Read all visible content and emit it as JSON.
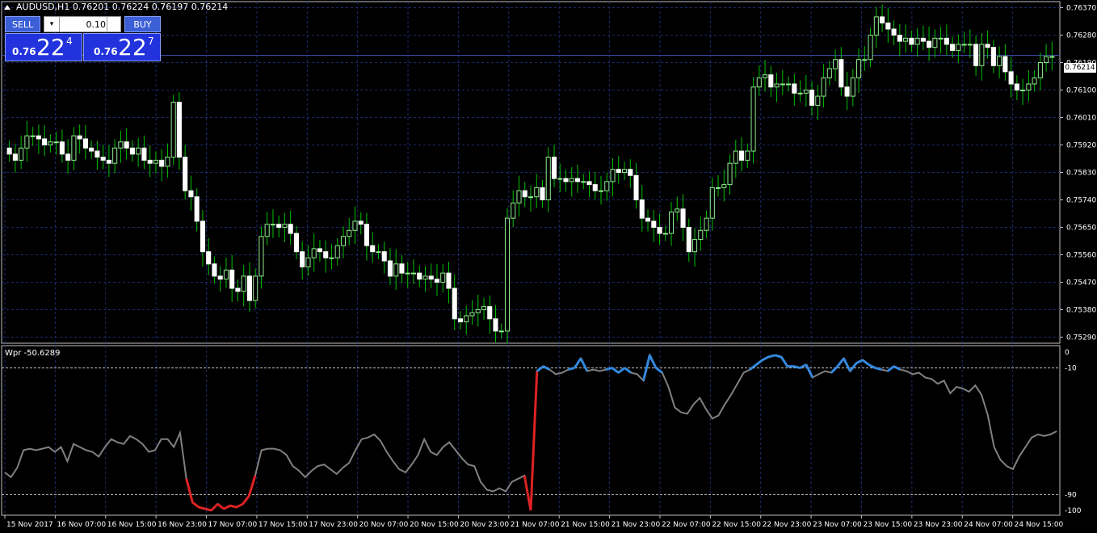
{
  "header": {
    "title": "AUDUSD,H1  0.76201 0.76224 0.76197 0.76214"
  },
  "trade_panel": {
    "sell_label": "SELL",
    "buy_label": "BUY",
    "lot_value": "0.10",
    "sell_price_prefix": "0.76",
    "sell_price_big": "22",
    "sell_price_sup": "4",
    "buy_price_prefix": "0.76",
    "buy_price_big": "22",
    "buy_price_sup": "7"
  },
  "indicator": {
    "label": "Wpr -50.6289"
  },
  "current_price": "0.76214",
  "colors": {
    "bull": "#90ee90",
    "bear": "#ffffff",
    "wick": "#00c000",
    "grid": "#1e2a6e",
    "wpr_line": "#808080",
    "wpr_high": "#3388dd",
    "wpr_low": "#dd2222"
  },
  "chart_data": [
    {
      "type": "candlestick",
      "price_ticks": [
        "0.76370",
        "0.76280",
        "0.76190",
        "0.76100",
        "0.76010",
        "0.75920",
        "0.75830",
        "0.75740",
        "0.75650",
        "0.75560",
        "0.75470",
        "0.75380",
        "0.75290"
      ],
      "ylim": [
        0.7527,
        0.7639
      ],
      "x_labels": [
        "15 Nov 2017",
        "16 Nov 07:00",
        "16 Nov 15:00",
        "16 Nov 23:00",
        "17 Nov 07:00",
        "17 Nov 15:00",
        "17 Nov 23:00",
        "20 Nov 07:00",
        "20 Nov 15:00",
        "20 Nov 23:00",
        "21 Nov 07:00",
        "21 Nov 15:00",
        "21 Nov 23:00",
        "22 Nov 07:00",
        "22 Nov 15:00",
        "22 Nov 23:00",
        "23 Nov 07:00",
        "23 Nov 15:00",
        "23 Nov 23:00",
        "24 Nov 07:00",
        "24 Nov 15:00"
      ],
      "closes": [
        0.7589,
        0.7587,
        0.7591,
        0.7595,
        0.7595,
        0.7594,
        0.7592,
        0.7593,
        0.7593,
        0.7589,
        0.7587,
        0.7595,
        0.7594,
        0.7591,
        0.759,
        0.7588,
        0.7587,
        0.7586,
        0.7591,
        0.7593,
        0.7591,
        0.7589,
        0.7591,
        0.7587,
        0.7586,
        0.7587,
        0.7585,
        0.7588,
        0.7606,
        0.7588,
        0.7577,
        0.7575,
        0.7567,
        0.7557,
        0.7553,
        0.7549,
        0.7548,
        0.7551,
        0.7545,
        0.7544,
        0.7549,
        0.7541,
        0.7549,
        0.7562,
        0.7566,
        0.7566,
        0.7565,
        0.7566,
        0.7563,
        0.7557,
        0.7552,
        0.7555,
        0.7558,
        0.7557,
        0.7555,
        0.7555,
        0.7559,
        0.7562,
        0.7564,
        0.7567,
        0.7566,
        0.7559,
        0.7557,
        0.7557,
        0.7554,
        0.7549,
        0.7553,
        0.755,
        0.755,
        0.755,
        0.7548,
        0.7549,
        0.7548,
        0.7547,
        0.755,
        0.7545,
        0.7535,
        0.7534,
        0.7536,
        0.7537,
        0.7538,
        0.7539,
        0.7535,
        0.7531,
        0.7531,
        0.7568,
        0.7573,
        0.7577,
        0.7575,
        0.7575,
        0.7578,
        0.7574,
        0.7588,
        0.7581,
        0.7581,
        0.758,
        0.7581,
        0.758,
        0.758,
        0.7579,
        0.7577,
        0.7577,
        0.758,
        0.7584,
        0.7583,
        0.7584,
        0.7582,
        0.7574,
        0.7568,
        0.7567,
        0.7565,
        0.7563,
        0.7563,
        0.757,
        0.7571,
        0.7565,
        0.7557,
        0.7561,
        0.7564,
        0.7568,
        0.7578,
        0.7578,
        0.7579,
        0.7586,
        0.759,
        0.7587,
        0.759,
        0.7611,
        0.7614,
        0.7615,
        0.7611,
        0.7612,
        0.7612,
        0.7612,
        0.7609,
        0.7609,
        0.761,
        0.7605,
        0.7608,
        0.7614,
        0.7617,
        0.762,
        0.7611,
        0.7608,
        0.7614,
        0.762,
        0.762,
        0.7628,
        0.7634,
        0.7632,
        0.763,
        0.7628,
        0.7626,
        0.7627,
        0.7625,
        0.7627,
        0.7626,
        0.7624,
        0.7627,
        0.7627,
        0.7625,
        0.7623,
        0.7625,
        0.7625,
        0.7625,
        0.7618,
        0.7625,
        0.7624,
        0.7618,
        0.7621,
        0.7616,
        0.7612,
        0.761,
        0.761,
        0.7612,
        0.7614,
        0.7619,
        0.7621,
        0.7621
      ]
    },
    {
      "type": "line",
      "name": "Wpr",
      "ticks": [
        "0",
        "-10",
        "-90",
        "-100"
      ],
      "levels": [
        -10,
        -90
      ],
      "ylim": [
        -100,
        0
      ],
      "values": [
        -76,
        -79,
        -73,
        -62,
        -61,
        -62,
        -61,
        -60,
        -63,
        -60,
        -69,
        -58,
        -60,
        -62,
        -63,
        -66,
        -60,
        -55,
        -57,
        -58,
        -53,
        -55,
        -58,
        -63,
        -62,
        -55,
        -55,
        -60,
        -51,
        -80,
        -95,
        -98,
        -99,
        -100,
        -96,
        -99,
        -97,
        -98,
        -96,
        -91,
        -78,
        -62,
        -61,
        -61,
        -62,
        -65,
        -72,
        -75,
        -79,
        -75,
        -72,
        -71,
        -74,
        -77,
        -73,
        -70,
        -62,
        -55,
        -54,
        -52,
        -56,
        -63,
        -69,
        -74,
        -76,
        -71,
        -65,
        -55,
        -63,
        -65,
        -60,
        -57,
        -62,
        -67,
        -71,
        -72,
        -82,
        -87,
        -88,
        -86,
        -88,
        -82,
        -80,
        -78,
        -100,
        -12,
        -9,
        -11,
        -14,
        -13,
        -11,
        -10,
        -4,
        -12,
        -11,
        -12,
        -11,
        -10,
        -13,
        -10,
        -13,
        -14,
        -18,
        -2,
        -10,
        -13,
        -22,
        -35,
        -38,
        -39,
        -33,
        -29,
        -36,
        -42,
        -40,
        -33,
        -27,
        -20,
        -13,
        -11,
        -8,
        -5,
        -3,
        -2,
        -3,
        -9,
        -9,
        -10,
        -8,
        -16,
        -14,
        -12,
        -13,
        -9,
        -4,
        -12,
        -7,
        -5,
        -8,
        -10,
        -11,
        -12,
        -9,
        -11,
        -12,
        -14,
        -13,
        -16,
        -17,
        -20,
        -18,
        -26,
        -22,
        -23,
        -25,
        -21,
        -27,
        -40,
        -60,
        -68,
        -72,
        -74,
        -66,
        -60,
        -54,
        -52,
        -53,
        -52,
        -50
      ]
    }
  ]
}
